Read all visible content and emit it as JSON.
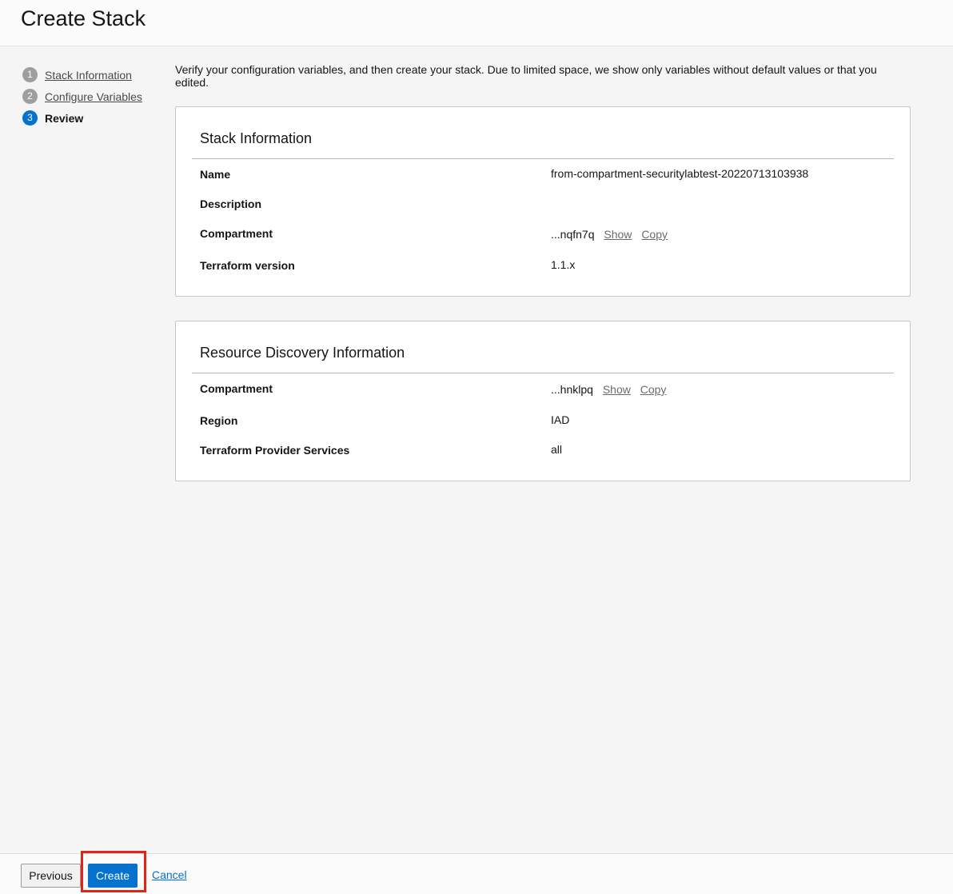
{
  "header": {
    "title": "Create Stack"
  },
  "steps": [
    {
      "number": "1",
      "label": "Stack Information"
    },
    {
      "number": "2",
      "label": "Configure Variables"
    },
    {
      "number": "3",
      "label": "Review"
    }
  ],
  "intro": "Verify your configuration variables, and then create your stack. Due to limited space, we show only variables without default values or that you edited.",
  "stack_info": {
    "title": "Stack Information",
    "rows": [
      {
        "label": "Name",
        "value": "from-compartment-securitylabtest-20220713103938"
      },
      {
        "label": "Description",
        "value": ""
      },
      {
        "label": "Compartment",
        "value": "...nqfn7q",
        "show": "Show",
        "copy": "Copy"
      },
      {
        "label": "Terraform version",
        "value": "1.1.x"
      }
    ]
  },
  "discovery_info": {
    "title": "Resource Discovery Information",
    "rows": [
      {
        "label": "Compartment",
        "value": "...hnklpq",
        "show": "Show",
        "copy": "Copy"
      },
      {
        "label": "Region",
        "value": "IAD"
      },
      {
        "label": "Terraform Provider Services",
        "value": "all"
      }
    ]
  },
  "footer": {
    "previous_label": "Previous",
    "create_label": "Create",
    "cancel_label": "Cancel"
  },
  "colors": {
    "primary": "#0572ce",
    "highlight": "#e2231a",
    "step_inactive": "#9e9e9e"
  }
}
